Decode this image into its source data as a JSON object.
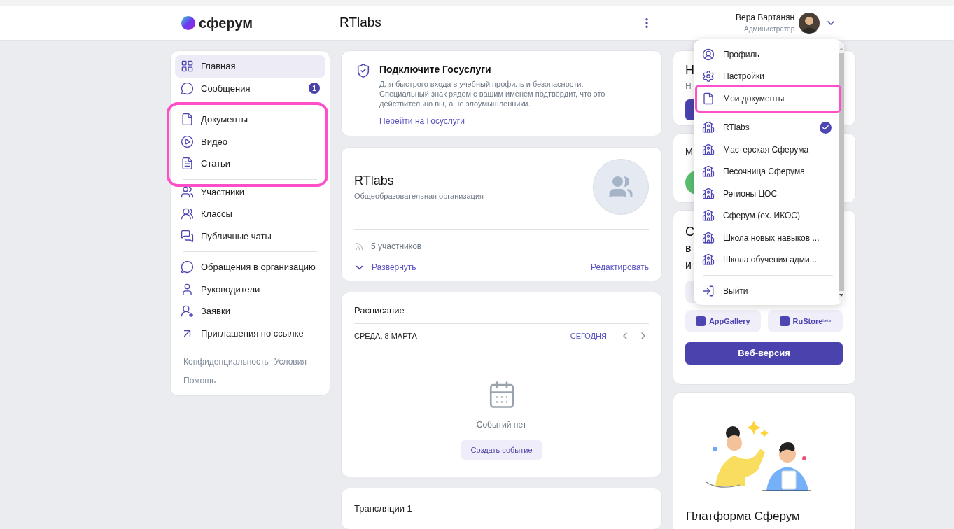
{
  "header": {
    "logo": "сферум",
    "title": "RTlabs",
    "user": {
      "name": "Вера Вартанян",
      "role": "Администратор"
    }
  },
  "sidebar": {
    "groups": [
      {
        "highlighted": false,
        "items": [
          {
            "label": "Главная",
            "selected": true
          },
          {
            "label": "Сообщения",
            "selected": false,
            "badge": "1"
          }
        ]
      },
      {
        "highlighted": true,
        "items": [
          {
            "label": "Документы",
            "selected": false
          },
          {
            "label": "Видео",
            "selected": false
          },
          {
            "label": "Статьи",
            "selected": false
          }
        ]
      },
      {
        "highlighted": false,
        "items": [
          {
            "label": "Участники",
            "selected": false
          },
          {
            "label": "Классы",
            "selected": false
          },
          {
            "label": "Публичные чаты",
            "selected": false
          }
        ]
      },
      {
        "highlighted": false,
        "items": [
          {
            "label": "Обращения в организацию",
            "selected": false
          },
          {
            "label": "Руководители",
            "selected": false
          },
          {
            "label": "Заявки",
            "selected": false
          },
          {
            "label": "Приглашения по ссылке",
            "selected": false
          }
        ]
      }
    ],
    "footer_links": [
      "Конфиденциальность",
      "Условия",
      "Помощь"
    ]
  },
  "gosuslugi": {
    "title": "Подключите Госуслуги",
    "text": "Для быстрого входа в учебный профиль и безопасности. Специальный знак рядом с вашим именем подтвердит, что это действительно вы, а не злоумышленники.",
    "link": "Перейти на Госуслуги"
  },
  "organization": {
    "name": "RTlabs",
    "type": "Общеобразовательная организация",
    "members": "5 участников",
    "expand": "Развернуть",
    "edit": "Редактировать"
  },
  "schedule": {
    "title": "Расписание",
    "date": "СРЕДА, 8 МАРТА",
    "today": "СЕГОДНЯ",
    "empty": "Событий нет",
    "create": "Создать событие"
  },
  "broadcasts": {
    "title": "Трансляции 1"
  },
  "right_cards": {
    "card_1": {
      "title": "Н",
      "subtitle": "Н"
    },
    "card_2": {
      "title": "М"
    },
    "card_3": {
      "lines": [
        "С",
        "в",
        "и"
      ],
      "store_buttons": [
        {
          "label": "AppGallery"
        },
        {
          "label": "RuStore",
          "sup": "beta"
        }
      ],
      "web_button": "Веб-версия"
    },
    "card_4": {
      "title": "Платформа Сферум"
    }
  },
  "menu": {
    "items": [
      {
        "kind": "profile",
        "label": "Профиль",
        "highlighted": false
      },
      {
        "kind": "settings",
        "label": "Настройки",
        "highlighted": false
      },
      {
        "kind": "documents",
        "label": "Мои документы",
        "highlighted": true
      },
      {
        "kind": "org",
        "label": "RTlabs",
        "selected": true
      },
      {
        "kind": "org",
        "label": "Мастерская Сферума",
        "selected": false
      },
      {
        "kind": "org",
        "label": "Песочница Сферума",
        "selected": false
      },
      {
        "kind": "org",
        "label": "Регионы ЦОС",
        "selected": false
      },
      {
        "kind": "org",
        "label": "Сферум (ex. ИКОС)",
        "selected": false
      },
      {
        "kind": "org",
        "label": "Школа новых навыков ...",
        "selected": false
      },
      {
        "kind": "org",
        "label": "Школа обучения адми...",
        "selected": false
      },
      {
        "kind": "logout",
        "label": "Выйти",
        "highlighted": false
      }
    ]
  }
}
